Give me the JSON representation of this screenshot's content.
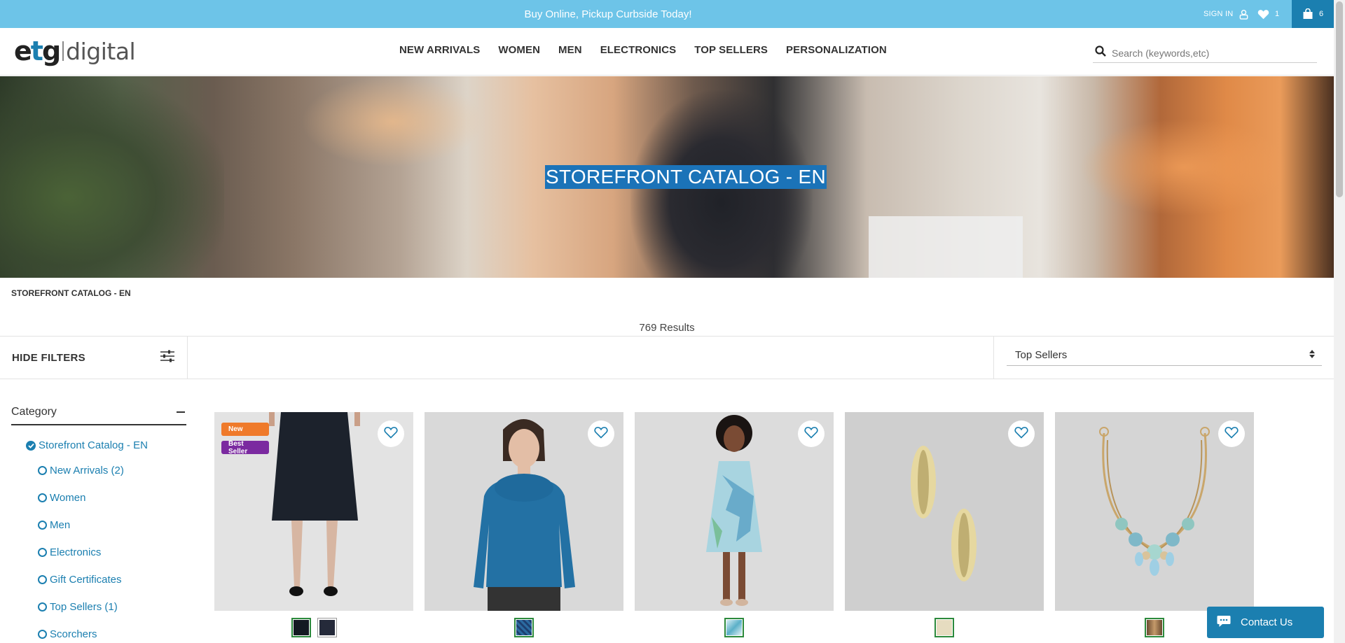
{
  "promo": {
    "text": "Buy Online, Pickup Curbside Today!"
  },
  "utility": {
    "sign_in": "SIGN IN",
    "wishlist_count": "1",
    "cart_count": "6"
  },
  "header": {
    "logo_main": "etg",
    "logo_sub": "digital",
    "nav": [
      "NEW ARRIVALS",
      "WOMEN",
      "MEN",
      "ELECTRONICS",
      "TOP SELLERS",
      "PERSONALIZATION"
    ],
    "search_placeholder": "Search (keywords,etc)"
  },
  "hero": {
    "title": "STOREFRONT CATALOG - EN"
  },
  "breadcrumb": "STOREFRONT CATALOG - EN",
  "results": "769 Results",
  "filters": {
    "toggle_label": "HIDE FILTERS",
    "sort_selected": "Top Sellers"
  },
  "sidebar": {
    "category_heading": "Category",
    "root": "Storefront Catalog - EN",
    "items": [
      "New Arrivals (2)",
      "Women",
      "Men",
      "Electronics",
      "Gift Certificates",
      "Top Sellers (1)",
      "Scorchers"
    ]
  },
  "products": [
    {
      "badges": [
        "New",
        "Best Seller"
      ],
      "swatch_colors": [
        "#141a22",
        "#252a3a"
      ]
    },
    {
      "badges": [],
      "swatch_colors": [
        "#2b6aa0"
      ]
    },
    {
      "badges": [],
      "swatch_colors": [
        "#8fc9d8"
      ]
    },
    {
      "badges": [],
      "swatch_colors": [
        "#e6dcc0"
      ]
    },
    {
      "badges": [],
      "swatch_colors": [
        "#8a6040"
      ]
    }
  ],
  "contact": {
    "label": "Contact Us"
  },
  "colors": {
    "brand_blue": "#1b7fb0",
    "promo_blue": "#6dc4e8",
    "badge_new": "#ef7a2a",
    "badge_best": "#7b2aa0"
  }
}
